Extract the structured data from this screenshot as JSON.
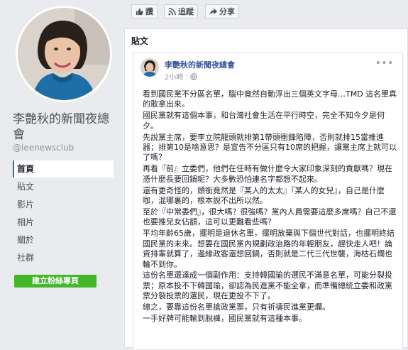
{
  "profile": {
    "page_name": "李艷秋的新聞夜總會",
    "handle": "@leenewsclub"
  },
  "nav": [
    {
      "label": "首頁",
      "active": true
    },
    {
      "label": "貼文",
      "active": false
    },
    {
      "label": "影片",
      "active": false
    },
    {
      "label": "相片",
      "active": false
    },
    {
      "label": "關於",
      "active": false
    },
    {
      "label": "社群",
      "active": false
    }
  ],
  "create_page_button": "建立粉絲專頁",
  "toolbar": {
    "like": "讚",
    "follow": "追蹤",
    "share": "分享"
  },
  "panel_title": "貼文",
  "post": {
    "author": "李艷秋的新聞夜總會",
    "time": "2小時",
    "paragraphs": [
      "看到國民黨不分區名單，腦中竟然自動浮出三個英文字母…TMD 這名單真的敢拿出來。",
      "國民黨就有這個本事，和台灣社會生活在平行時空，完全不知今夕是何夕。",
      "先說黨主席，要李立院龍頭就排第1帶頭衝鋒陷陣，否則就排15當推進器；排第10是啥意思？是宣告不分區只有10席的把握，讓黨主席上就可以了嗎？",
      "再看『前』立委們，他們在任時有做什麼令大家印象深刻的貢獻嗎？現在憑什麼長要回鍋呢？大多數恐怕連名字都想不起來。",
      "還有更奇怪的，頭銜竟然是『某人的太太』『某人的女兒』，自己是什麼咖，混哪裏的，根本說不出所以然。",
      "至於『中常委們』，很大嗎？很強嗎？黨內人員需要這麼多席嗎？自己不還也要推兒女佔額，這可以更難看些嗎？",
      "平均年齡65歲，擺明是退休名單，擺明放棄與下個世代對話，也擺明終結國民黨的未來。想要在國民黨內規劃政治路的年輕朋友，趕快走人吧！論資排輩就算了，邊緣政客還想回鍋，否則就是二代三代世襲，海枯石爛也輪不到你。",
      "這份名單還達成一個副作用：支持韓國瑜的選民不滿意名單，可能分裂投票；原本投不下韓國瑜，卻認為民進黨不能全拿，而準備總統立委和政黨票分裂投票的選民，現在更投不下了。",
      "總之，要靠這份名單搶政黨票，只有祈禱民進黨更爛。",
      "一手好牌可能輸到脫褲，國民黨就有這種本事。"
    ]
  },
  "colors": {
    "background": "#e9ebee",
    "link_blue": "#365899",
    "accent_blue": "#4267b2",
    "green": "#42b72a"
  }
}
